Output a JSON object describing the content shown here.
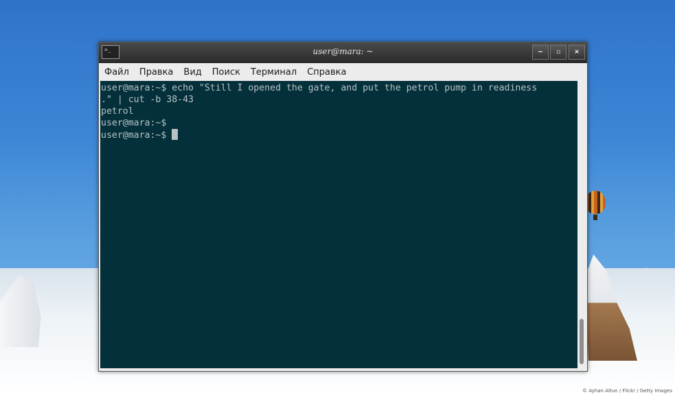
{
  "window": {
    "title": "user@mara: ~",
    "buttons": {
      "minimize": "‒",
      "maximize": "▫",
      "close": "×"
    }
  },
  "menu": {
    "items": [
      "Файл",
      "Правка",
      "Вид",
      "Поиск",
      "Терминал",
      "Справка"
    ]
  },
  "terminal": {
    "lines": [
      "user@mara:~$ echo \"Still I opened the gate, and put the petrol pump in readiness",
      ".\" | cut -b 38-43",
      "petrol",
      "user@mara:~$",
      "user@mara:~$ "
    ]
  },
  "wallpaper": {
    "credit": "© Ayhan Altun / Flickr / Getty Images"
  },
  "colors": {
    "terminal_bg": "#04303b",
    "terminal_fg": "#b7c3c5",
    "sky": "#3d86d6"
  }
}
